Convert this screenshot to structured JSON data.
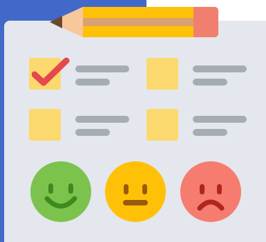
{
  "illustration": {
    "subject": "survey-checklist",
    "colors": {
      "background_blue": "#4169c9",
      "sheet": "#e4e7ed",
      "checkbox": "#fcd96e",
      "placeholder_line": "#a6acb4",
      "check": "#e5484d",
      "happy_face": "#7cc34e",
      "neutral_face": "#ffc107",
      "sad_face": "#f57c6f",
      "pencil_body": "#ffc107",
      "pencil_eraser": "#f07f6d"
    },
    "checkboxes": [
      {
        "checked": true
      },
      {
        "checked": false
      },
      {
        "checked": false
      },
      {
        "checked": false
      }
    ],
    "ratings": [
      "happy",
      "neutral",
      "sad"
    ]
  }
}
